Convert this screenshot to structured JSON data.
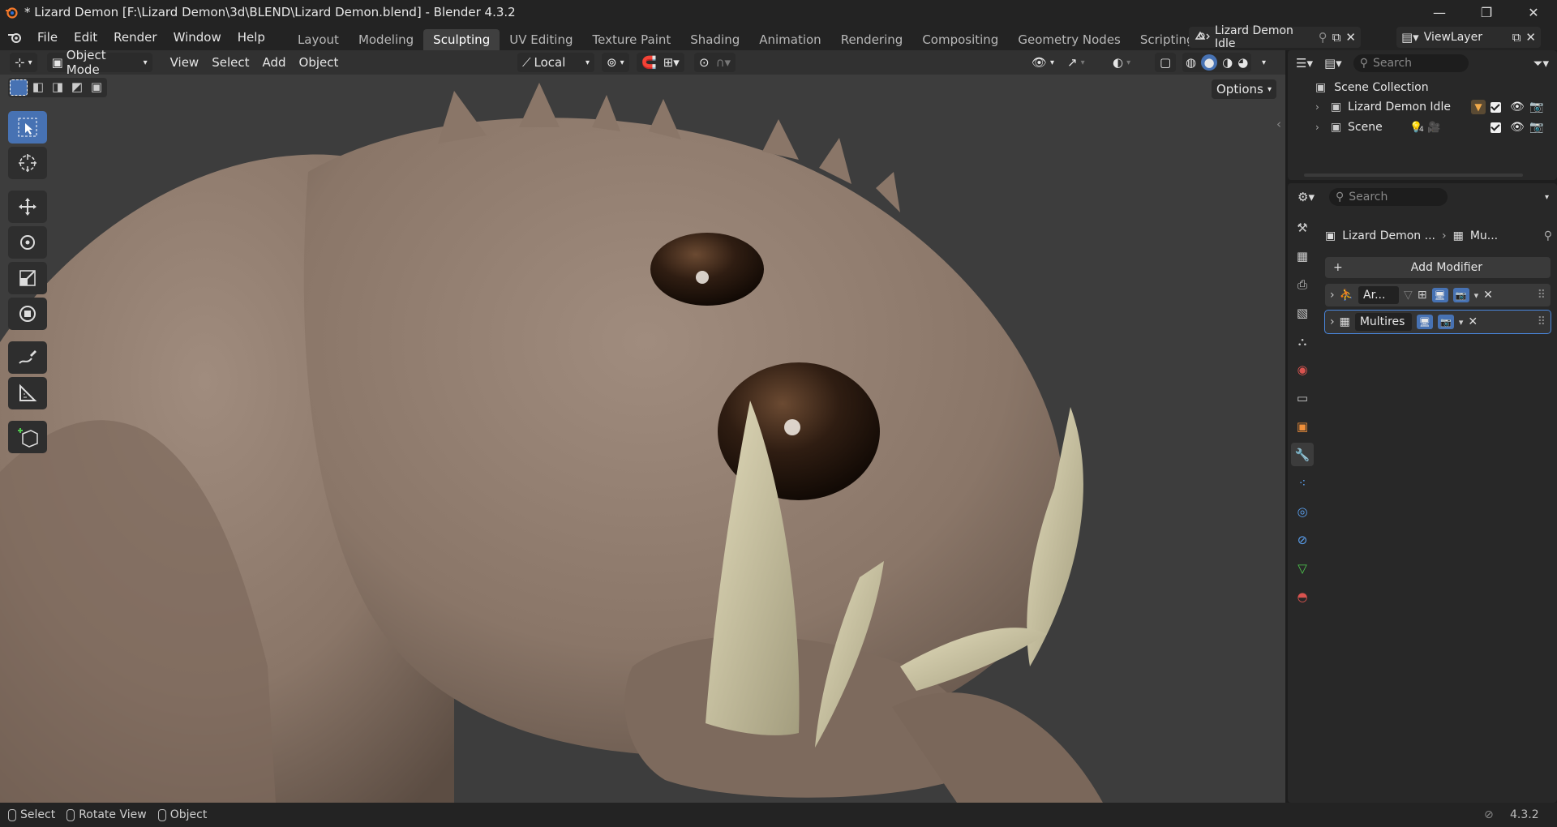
{
  "window": {
    "title": "* Lizard Demon [F:\\Lizard Demon\\3d\\BLEND\\Lizard Demon.blend] - Blender 4.3.2",
    "minimize": "—",
    "maximize": "❐",
    "close": "✕"
  },
  "menu": [
    "File",
    "Edit",
    "Render",
    "Window",
    "Help"
  ],
  "workspaces": [
    "Layout",
    "Modeling",
    "Sculpting",
    "UV Editing",
    "Texture Paint",
    "Shading",
    "Animation",
    "Rendering",
    "Compositing",
    "Geometry Nodes",
    "Scripting"
  ],
  "active_workspace": "Sculpting",
  "add_workspace": "+",
  "scene_selector": {
    "value": "Lizard Demon Idle"
  },
  "viewlayer_selector": {
    "value": "ViewLayer"
  },
  "viewport_header": {
    "mode": "Object Mode",
    "menus": [
      "View",
      "Select",
      "Add",
      "Object"
    ],
    "orientation": "Local",
    "options_label": "Options"
  },
  "outliner": {
    "search_placeholder": "Search",
    "root": "Scene Collection",
    "items": [
      {
        "label": "Lizard Demon Idle"
      },
      {
        "label": "Scene",
        "badge": "4"
      }
    ]
  },
  "properties": {
    "search_placeholder": "Search",
    "breadcrumb_object": "Lizard Demon ...",
    "breadcrumb_modifier": "Mu...",
    "add_modifier": "Add Modifier",
    "modifiers": [
      {
        "name": "Ar...",
        "type": "armature"
      },
      {
        "name": "Multires",
        "type": "multires"
      }
    ]
  },
  "statusbar": {
    "select": "Select",
    "rotate": "Rotate View",
    "object": "Object",
    "version": "4.3.2"
  },
  "colors": {
    "accent": "#4772b3",
    "active_tab": "#3f3f3f",
    "viewport_bg": "#3d3d3d",
    "clay": "#8f7c6e",
    "teeth": "#cfc7a4",
    "eye": "#2a1a0f"
  }
}
